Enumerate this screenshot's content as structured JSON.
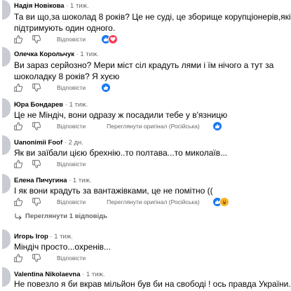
{
  "labels": {
    "reply": "Відповісти",
    "see_original": "Переглянути оригінал (Російська)",
    "more_replies": "Переглянути 1 відповідь"
  },
  "comments": [
    {
      "author": "Надія Новікова",
      "time": "· 1 тиж.",
      "text": "Та ви що,за шоколад 8 років? Це не суді, це зборище корупціонерів,які підтримують один одного.",
      "reactions": [
        "like",
        "love"
      ]
    },
    {
      "author": "Олечка Корольчук",
      "time": "· 1 тиж.",
      "text": "Ви зараз серйозно? Мери міст сіл крадуть лями і їм нічого а тут за шоколадку 8 років? Я хуєю",
      "reactions": [
        "like"
      ]
    },
    {
      "author": "Юра Бондарев",
      "time": "· 1 тиж.",
      "text": "Це не Міндіч, вони одразу ж посадили тебе у в'язницю",
      "reactions": [
        "like"
      ]
    },
    {
      "author": "Uanonimii Foof",
      "time": "· 2 дн.",
      "text": "Як ви заїбали цією брехнію..то полтава...то миколаїв..."
    },
    {
      "author": "Елена Пичугина",
      "time": "· 1 тиж.",
      "text": "І як вони крадуть за вантажівками, це не помітно ((",
      "reactions": [
        "like",
        "haha"
      ]
    },
    {
      "author": "Игорь Ігор",
      "time": "· 1 тиж.",
      "text": "Міндіч просто...охренів..."
    },
    {
      "author": "Valentina Nikolaevna",
      "time": "· 1 тиж.",
      "text": "Не повезло я би вкрав мільйон був би на свободі ! ось правда України."
    }
  ],
  "colors": {
    "like": "#1877f2",
    "love": "#f33e58",
    "haha": "#f7b125",
    "secondary_text": "#65676b",
    "avatar_placeholder": "#c8ccd2"
  },
  "icons": [
    "like-thumb-icon",
    "dislike-thumb-icon",
    "chevron-return-icon",
    "heart-icon",
    "haha-face-icon"
  ]
}
